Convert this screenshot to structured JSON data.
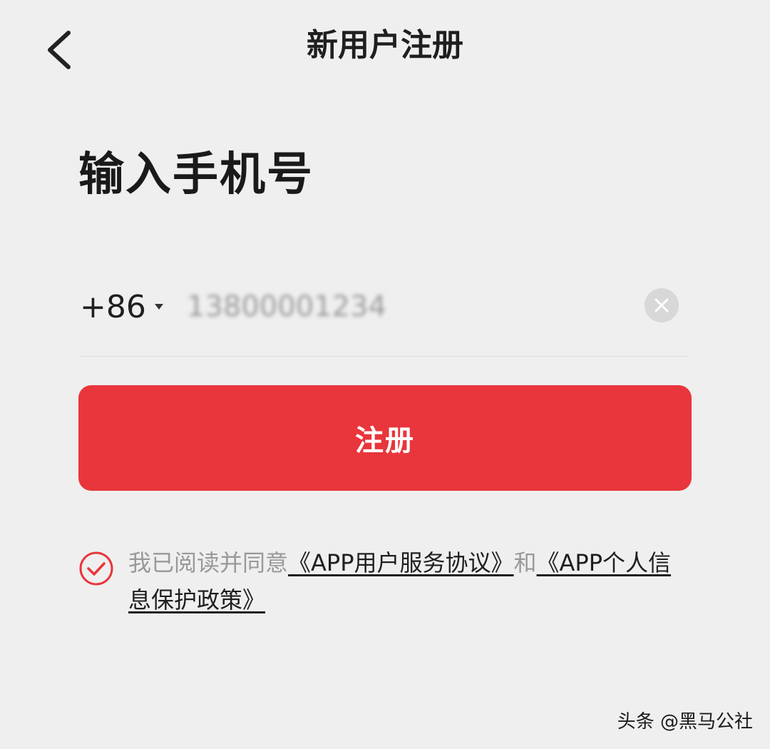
{
  "header": {
    "title": "新用户注册",
    "back_icon": "chevron-left-icon"
  },
  "heading": "输入手机号",
  "phone": {
    "country_code": "+86",
    "value": "13800001234",
    "clear_icon": "close-circle-icon"
  },
  "register_button": {
    "label": "注册",
    "color": "#e8363c"
  },
  "agreement": {
    "checked": true,
    "check_icon": "checkmark-circle-icon",
    "prefix": "我已阅读并同意",
    "link1": "《APP用户服务协议》",
    "middle": "和",
    "link2": "《APP个人信息保护政策》"
  },
  "watermark": "头条 @黑马公社"
}
